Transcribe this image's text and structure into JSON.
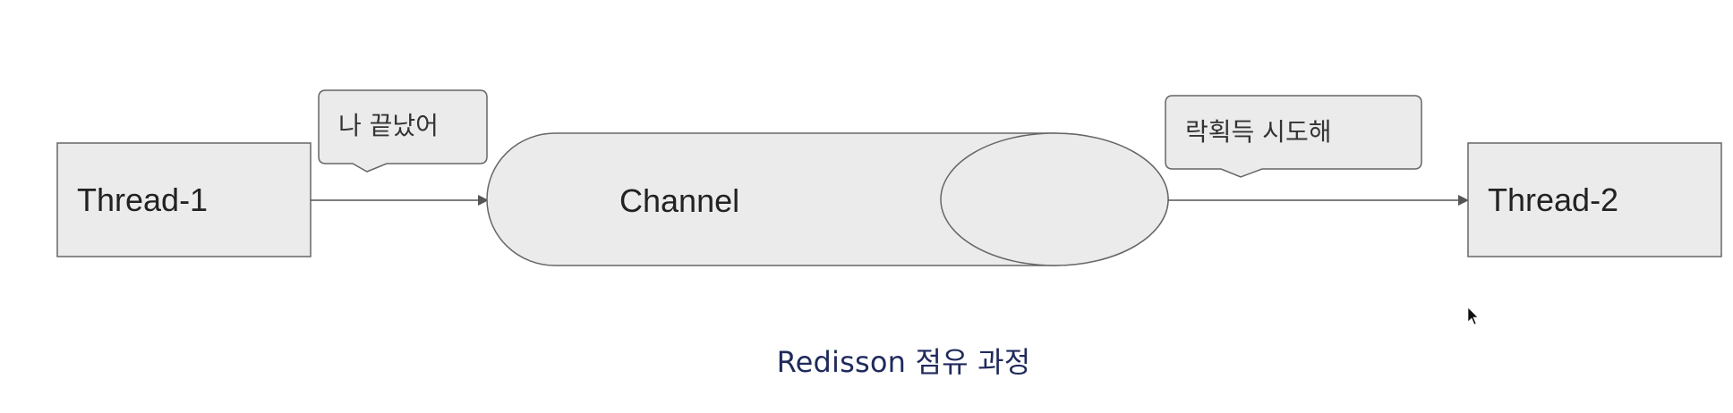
{
  "diagram": {
    "thread1_label": "Thread-1",
    "thread2_label": "Thread-2",
    "channel_label": "Channel",
    "bubble_left_text": "나 끝났어",
    "bubble_right_text": "락획득 시도해",
    "colors": {
      "box_fill": "#ebebeb",
      "box_stroke": "#666666",
      "arrow": "#555555"
    }
  },
  "caption": "Redisson 점유 과정"
}
